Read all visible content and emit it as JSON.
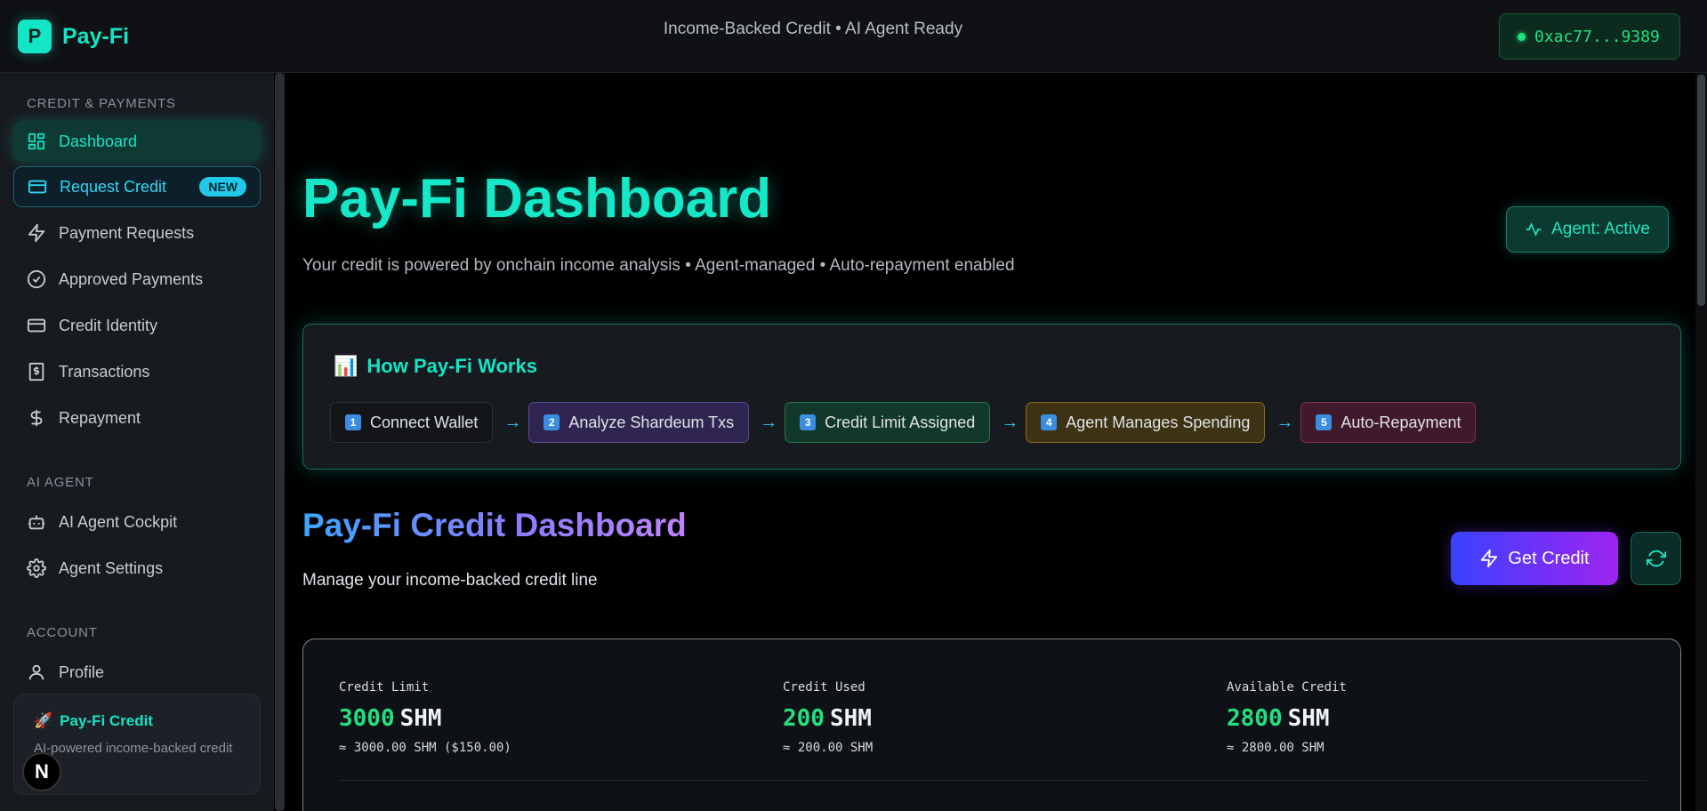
{
  "app": {
    "logo_letter": "P",
    "name": "Pay-Fi"
  },
  "topbar": {
    "tagline": "Income-Backed Credit • AI Agent Ready",
    "wallet": "0xac77...9389"
  },
  "sidebar": {
    "sections": [
      {
        "label": "CREDIT & PAYMENTS"
      },
      {
        "label": "AI AGENT"
      },
      {
        "label": "ACCOUNT"
      }
    ],
    "items": [
      {
        "label": "Dashboard",
        "icon": "grid-icon"
      },
      {
        "label": "Request Credit",
        "icon": "card-icon",
        "badge": "NEW"
      },
      {
        "label": "Payment Requests",
        "icon": "bolt-icon"
      },
      {
        "label": "Approved Payments",
        "icon": "check-circle-icon"
      },
      {
        "label": "Credit Identity",
        "icon": "id-card-icon"
      },
      {
        "label": "Transactions",
        "icon": "receipt-icon"
      },
      {
        "label": "Repayment",
        "icon": "dollar-icon"
      },
      {
        "label": "AI Agent Cockpit",
        "icon": "robot-icon"
      },
      {
        "label": "Agent Settings",
        "icon": "gear-icon"
      },
      {
        "label": "Profile",
        "icon": "user-icon"
      }
    ],
    "promo": {
      "emoji": "🚀",
      "title": "Pay-Fi Credit",
      "desc": "AI-powered income-backed credit"
    },
    "n_badge": "N"
  },
  "main": {
    "title": "Pay-Fi Dashboard",
    "subtitle": "Your credit is powered by onchain income analysis • Agent-managed • Auto-repayment enabled",
    "agent_status": "Agent: Active",
    "how": {
      "emoji": "📊",
      "title": "How Pay-Fi Works",
      "steps": [
        {
          "num": "1",
          "label": "Connect Wallet"
        },
        {
          "num": "2",
          "label": "Analyze Shardeum Txs"
        },
        {
          "num": "3",
          "label": "Credit Limit Assigned"
        },
        {
          "num": "4",
          "label": "Agent Manages Spending"
        },
        {
          "num": "5",
          "label": "Auto-Repayment"
        }
      ]
    },
    "credit": {
      "title": "Pay-Fi Credit Dashboard",
      "subtitle": "Manage your income-backed credit line",
      "get_credit_label": "Get Credit"
    },
    "stats": [
      {
        "label": "Credit Limit",
        "value": "3000",
        "unit": "SHM",
        "approx": "≈ 3000.00 SHM ($150.00)"
      },
      {
        "label": "Credit Used",
        "value": "200",
        "unit": "SHM",
        "approx": "≈ 200.00 SHM"
      },
      {
        "label": "Available Credit",
        "value": "2800",
        "unit": "SHM",
        "approx": "≈ 2800.00 SHM"
      }
    ]
  },
  "colors": {
    "accent": "#14e3c4",
    "positive": "#22e07f",
    "brand_gradient_start": "#3b42ff",
    "brand_gradient_end": "#9e24f0"
  }
}
